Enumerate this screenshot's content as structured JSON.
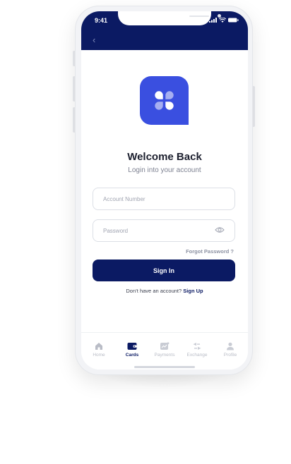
{
  "status_bar": {
    "time": "9:41"
  },
  "header": {
    "back_icon": "‹"
  },
  "login": {
    "title": "Welcome Back",
    "subtitle": "Login into your account",
    "account_placeholder": "Account Number",
    "password_placeholder": "Password",
    "forgot_label": "Forgot Password ?",
    "signin_label": "Sign In",
    "signup_prompt": "Don’t have an account?",
    "signup_link": "Sign Up"
  },
  "nav": {
    "active": "Cards",
    "items": [
      {
        "label": "Home",
        "icon": "home-icon"
      },
      {
        "label": "Cards",
        "icon": "wallet-icon"
      },
      {
        "label": "Payments",
        "icon": "chart-icon"
      },
      {
        "label": "Exchange",
        "icon": "exchange-icon"
      },
      {
        "label": "Profile",
        "icon": "profile-icon"
      }
    ]
  },
  "colors": {
    "primary": "#0b1a63",
    "logo": "#3a4fe0",
    "muted": "#b9bcc6"
  }
}
